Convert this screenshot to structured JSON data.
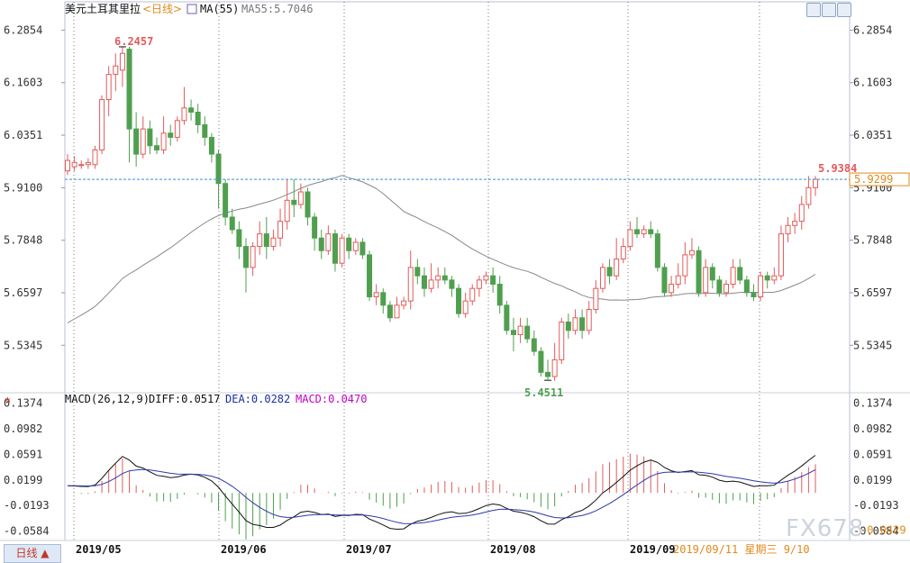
{
  "header": {
    "instrument": "美元土耳其里拉",
    "period": "日线",
    "ma_label": "MA(55)",
    "ma_value": "MA55:5.7046"
  },
  "macd_header": {
    "name": "MACD(26,12,9)",
    "diff": "DIFF:0.0517",
    "dea": "DEA:0.0282",
    "macd": "MACD:0.0470"
  },
  "period_button": "日线 ▲",
  "watermark": "FX678",
  "colors": {
    "up": "#e25b5b",
    "down": "#4f9f4f",
    "ma": "#888888",
    "diff": "#111111",
    "dea": "#2b3aa8",
    "macd_label": "#c400c4",
    "dea_label": "#1b2f9f"
  },
  "icons": [
    "zoom-in-icon",
    "zoom-out-icon",
    "close-icon"
  ],
  "chart_data": {
    "type": "candlestick",
    "price_ticks": [
      "6.2854",
      "6.1603",
      "6.0351",
      "5.9100",
      "5.7848",
      "5.6597",
      "5.5345"
    ],
    "ylim": [
      5.43,
      6.31
    ],
    "annotations": {
      "high": "6.2457",
      "low": "5.4511",
      "last_high": "5.9384"
    },
    "last_price": "5.9299",
    "dates": [
      "2019/05",
      "2019/06",
      "2019/07",
      "2019/08",
      "2019/09"
    ],
    "cursor_date": "2019/09/11  星期三  9/10",
    "candles": [
      [
        5.95,
        5.975,
        5.94,
        5.99
      ],
      [
        5.96,
        5.97,
        5.95,
        5.985
      ],
      [
        5.965,
        5.965,
        5.955,
        5.975
      ],
      [
        5.965,
        5.97,
        5.955,
        5.98
      ],
      [
        5.965,
        6.0,
        5.955,
        6.01
      ],
      [
        6.0,
        6.12,
        5.99,
        6.13
      ],
      [
        6.12,
        6.18,
        6.08,
        6.2
      ],
      [
        6.18,
        6.2,
        6.14,
        6.23
      ],
      [
        6.19,
        6.23,
        6.15,
        6.246
      ],
      [
        6.24,
        6.05,
        5.97,
        6.246
      ],
      [
        6.05,
        5.99,
        5.96,
        6.09
      ],
      [
        5.99,
        6.05,
        5.98,
        6.08
      ],
      [
        6.05,
        6.01,
        5.99,
        6.07
      ],
      [
        6.01,
        6.0,
        5.99,
        6.03
      ],
      [
        6.0,
        6.04,
        5.99,
        6.08
      ],
      [
        6.04,
        6.03,
        6.01,
        6.06
      ],
      [
        6.03,
        6.07,
        6.02,
        6.08
      ],
      [
        6.07,
        6.1,
        6.06,
        6.15
      ],
      [
        6.1,
        6.09,
        6.07,
        6.12
      ],
      [
        6.09,
        6.06,
        6.04,
        6.11
      ],
      [
        6.06,
        6.03,
        6.01,
        6.08
      ],
      [
        6.03,
        5.99,
        5.97,
        6.04
      ],
      [
        5.99,
        5.92,
        5.86,
        6.0
      ],
      [
        5.92,
        5.84,
        5.82,
        5.93
      ],
      [
        5.84,
        5.81,
        5.8,
        5.86
      ],
      [
        5.81,
        5.77,
        5.74,
        5.83
      ],
      [
        5.77,
        5.72,
        5.66,
        5.79
      ],
      [
        5.72,
        5.77,
        5.7,
        5.78
      ],
      [
        5.77,
        5.8,
        5.75,
        5.83
      ],
      [
        5.8,
        5.77,
        5.74,
        5.84
      ],
      [
        5.77,
        5.79,
        5.76,
        5.81
      ],
      [
        5.79,
        5.83,
        5.77,
        5.86
      ],
      [
        5.83,
        5.88,
        5.81,
        5.93
      ],
      [
        5.88,
        5.87,
        5.84,
        5.93
      ],
      [
        5.87,
        5.9,
        5.86,
        5.92
      ],
      [
        5.9,
        5.84,
        5.82,
        5.91
      ],
      [
        5.84,
        5.79,
        5.76,
        5.85
      ],
      [
        5.79,
        5.76,
        5.74,
        5.81
      ],
      [
        5.76,
        5.8,
        5.75,
        5.82
      ],
      [
        5.8,
        5.73,
        5.71,
        5.81
      ],
      [
        5.73,
        5.79,
        5.72,
        5.8
      ],
      [
        5.79,
        5.76,
        5.74,
        5.8
      ],
      [
        5.76,
        5.78,
        5.75,
        5.79
      ],
      [
        5.78,
        5.75,
        5.74,
        5.79
      ],
      [
        5.75,
        5.65,
        5.64,
        5.76
      ],
      [
        5.65,
        5.66,
        5.63,
        5.68
      ],
      [
        5.66,
        5.63,
        5.61,
        5.67
      ],
      [
        5.63,
        5.6,
        5.59,
        5.64
      ],
      [
        5.6,
        5.63,
        5.6,
        5.65
      ],
      [
        5.63,
        5.64,
        5.62,
        5.65
      ],
      [
        5.64,
        5.72,
        5.62,
        5.76
      ],
      [
        5.72,
        5.7,
        5.68,
        5.74
      ],
      [
        5.7,
        5.67,
        5.65,
        5.72
      ],
      [
        5.67,
        5.69,
        5.66,
        5.73
      ],
      [
        5.69,
        5.7,
        5.67,
        5.72
      ],
      [
        5.7,
        5.69,
        5.68,
        5.72
      ],
      [
        5.69,
        5.67,
        5.65,
        5.7
      ],
      [
        5.67,
        5.61,
        5.6,
        5.68
      ],
      [
        5.61,
        5.64,
        5.6,
        5.66
      ],
      [
        5.64,
        5.67,
        5.63,
        5.68
      ],
      [
        5.67,
        5.69,
        5.65,
        5.7
      ],
      [
        5.69,
        5.7,
        5.68,
        5.71
      ],
      [
        5.7,
        5.68,
        5.66,
        5.72
      ],
      [
        5.68,
        5.63,
        5.61,
        5.7
      ],
      [
        5.63,
        5.57,
        5.56,
        5.64
      ],
      [
        5.57,
        5.56,
        5.52,
        5.6
      ],
      [
        5.56,
        5.58,
        5.54,
        5.6
      ],
      [
        5.58,
        5.55,
        5.54,
        5.6
      ],
      [
        5.55,
        5.52,
        5.51,
        5.57
      ],
      [
        5.52,
        5.47,
        5.46,
        5.53
      ],
      [
        5.47,
        5.46,
        5.451,
        5.5
      ],
      [
        5.46,
        5.5,
        5.45,
        5.54
      ],
      [
        5.5,
        5.59,
        5.49,
        5.6
      ],
      [
        5.59,
        5.57,
        5.55,
        5.61
      ],
      [
        5.57,
        5.6,
        5.56,
        5.62
      ],
      [
        5.6,
        5.57,
        5.55,
        5.62
      ],
      [
        5.57,
        5.62,
        5.56,
        5.64
      ],
      [
        5.62,
        5.67,
        5.61,
        5.69
      ],
      [
        5.67,
        5.72,
        5.66,
        5.73
      ],
      [
        5.72,
        5.7,
        5.68,
        5.74
      ],
      [
        5.7,
        5.74,
        5.69,
        5.79
      ],
      [
        5.74,
        5.77,
        5.73,
        5.79
      ],
      [
        5.77,
        5.81,
        5.76,
        5.83
      ],
      [
        5.81,
        5.8,
        5.79,
        5.84
      ],
      [
        5.8,
        5.81,
        5.79,
        5.82
      ],
      [
        5.81,
        5.8,
        5.79,
        5.83
      ],
      [
        5.8,
        5.72,
        5.71,
        5.81
      ],
      [
        5.72,
        5.66,
        5.65,
        5.73
      ],
      [
        5.66,
        5.68,
        5.65,
        5.7
      ],
      [
        5.68,
        5.7,
        5.67,
        5.73
      ],
      [
        5.7,
        5.75,
        5.68,
        5.78
      ],
      [
        5.75,
        5.76,
        5.74,
        5.79
      ],
      [
        5.76,
        5.66,
        5.65,
        5.77
      ],
      [
        5.66,
        5.72,
        5.65,
        5.74
      ],
      [
        5.72,
        5.69,
        5.67,
        5.73
      ],
      [
        5.69,
        5.66,
        5.65,
        5.7
      ],
      [
        5.66,
        5.68,
        5.65,
        5.69
      ],
      [
        5.68,
        5.72,
        5.67,
        5.74
      ],
      [
        5.72,
        5.69,
        5.68,
        5.74
      ],
      [
        5.69,
        5.66,
        5.65,
        5.7
      ],
      [
        5.66,
        5.65,
        5.64,
        5.68
      ],
      [
        5.65,
        5.7,
        5.64,
        5.71
      ],
      [
        5.7,
        5.69,
        5.67,
        5.71
      ],
      [
        5.69,
        5.7,
        5.68,
        5.72
      ],
      [
        5.7,
        5.8,
        5.69,
        5.82
      ],
      [
        5.8,
        5.82,
        5.78,
        5.84
      ],
      [
        5.82,
        5.83,
        5.8,
        5.85
      ],
      [
        5.83,
        5.87,
        5.81,
        5.89
      ],
      [
        5.87,
        5.91,
        5.86,
        5.938
      ],
      [
        5.91,
        5.93,
        5.89,
        5.938
      ]
    ],
    "macd_ticks": [
      "0.1374",
      "0.0982",
      "0.0591",
      "0.0199",
      "-0.0193",
      "-0.0584",
      "-0.0429"
    ],
    "macd_ylim": [
      -0.07,
      0.145
    ]
  }
}
